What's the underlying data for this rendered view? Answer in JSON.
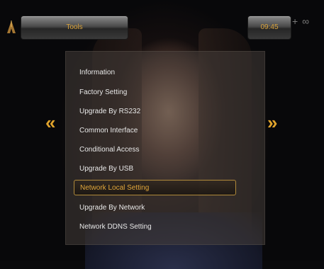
{
  "header": {
    "title": "Tools",
    "clock": "09:45"
  },
  "menu": {
    "items": [
      {
        "label": "Information",
        "selected": false
      },
      {
        "label": "Factory Setting",
        "selected": false
      },
      {
        "label": "Upgrade By RS232",
        "selected": false
      },
      {
        "label": "Common Interface",
        "selected": false
      },
      {
        "label": "Conditional Access",
        "selected": false
      },
      {
        "label": "Upgrade By USB",
        "selected": false
      },
      {
        "label": "Network Local Setting",
        "selected": true
      },
      {
        "label": "Upgrade By Network",
        "selected": false
      },
      {
        "label": "Network DDNS Setting",
        "selected": false
      }
    ]
  },
  "nav": {
    "left_arrow": "«",
    "right_arrow": "»"
  },
  "icons": {
    "corner": "antenna-logo-icon",
    "prev": "double-chevron-left-icon",
    "next": "double-chevron-right-icon"
  },
  "colors": {
    "accent": "#d9a23a",
    "menu_text": "#e8e8e8",
    "selected_border": "#b08a3a"
  }
}
